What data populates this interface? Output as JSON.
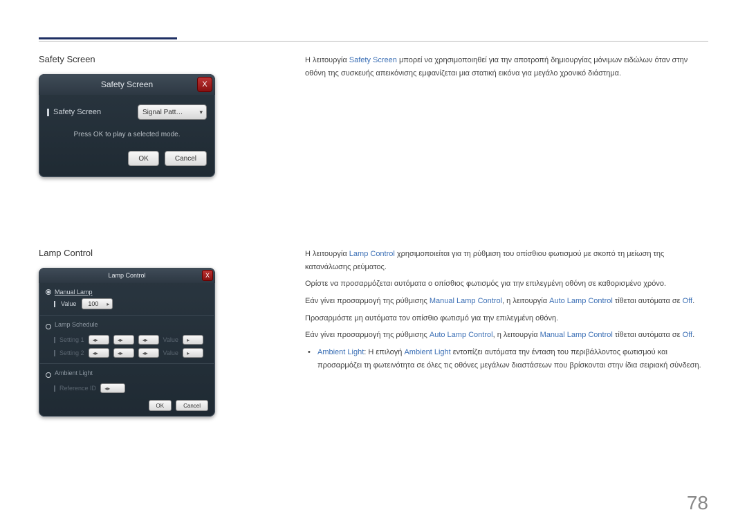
{
  "page_number": "78",
  "safety": {
    "title": "Safety Screen",
    "window_title": "Safety Screen",
    "field_label": "Safety Screen",
    "select_value": "Signal Patt…",
    "hint": "Press OK to play a selected mode.",
    "btn_ok": "OK",
    "btn_cancel": "Cancel",
    "close_icon": "X",
    "desc_prefix": "Η λειτουργία ",
    "desc_term": "Safety Screen",
    "desc_rest": " μπορεί να χρησιμοποιηθεί για την αποτροπή δημιουργίας μόνιμων ειδώλων όταν στην οθόνη της συσκευής απεικόνισης εμφανίζεται μια στατική εικόνα για μεγάλο χρονικό διάστημα."
  },
  "lamp": {
    "title": "Lamp Control",
    "window_title": "Lamp Control",
    "manual_lamp": "Manual Lamp",
    "value_label": "Value",
    "value": "100",
    "lamp_schedule": "Lamp Schedule",
    "setting1": "Setting 1",
    "setting2": "Setting 2",
    "value_dim": "Value",
    "ambient_light": "Ambient Light",
    "reference_id": "Reference ID",
    "btn_ok": "OK",
    "btn_cancel": "Cancel",
    "close_icon": "X",
    "p1_prefix": "Η λειτουργία ",
    "p1_term": "Lamp Control",
    "p1_rest": " χρησιμοποιείται για τη ρύθμιση του οπίσθιου φωτισμού με σκοπό τη μείωση της κατανάλωσης ρεύματος.",
    "p2": "Ορίστε να προσαρμόζεται αυτόματα ο οπίσθιος φωτισμός για την επιλεγμένη οθόνη σε καθορισμένο χρόνο.",
    "p3_prefix": "Εάν γίνει προσαρμογή της ρύθμισης ",
    "p3_t1": "Manual Lamp Control",
    "p3_mid": ", η λειτουργία ",
    "p3_t2": "Auto Lamp Control",
    "p3_end": " τίθεται αυτόματα σε ",
    "off": "Off",
    "p4": "Προσαρμόστε μη αυτόματα τον οπίσθιο φωτισμό για την επιλεγμένη οθόνη.",
    "p5_prefix": "Εάν γίνει προσαρμογή της ρύθμισης ",
    "p5_t1": "Auto Lamp Control",
    "p5_mid": ", η λειτουργία ",
    "p5_t2": "Manual Lamp Control",
    "p5_end": " τίθεται αυτόματα σε ",
    "bullet_prefix1": "Ambient Light",
    "bullet_prefix2": ": Η επιλογή ",
    "bullet_prefix3": "Ambient Light",
    "bullet_rest": " εντοπίζει αυτόματα την ένταση του περιβάλλοντος φωτισμού και προσαρμόζει τη φωτεινότητα σε όλες τις οθόνες μεγάλων διαστάσεων που βρίσκονται στην ίδια σειριακή σύνδεση."
  }
}
